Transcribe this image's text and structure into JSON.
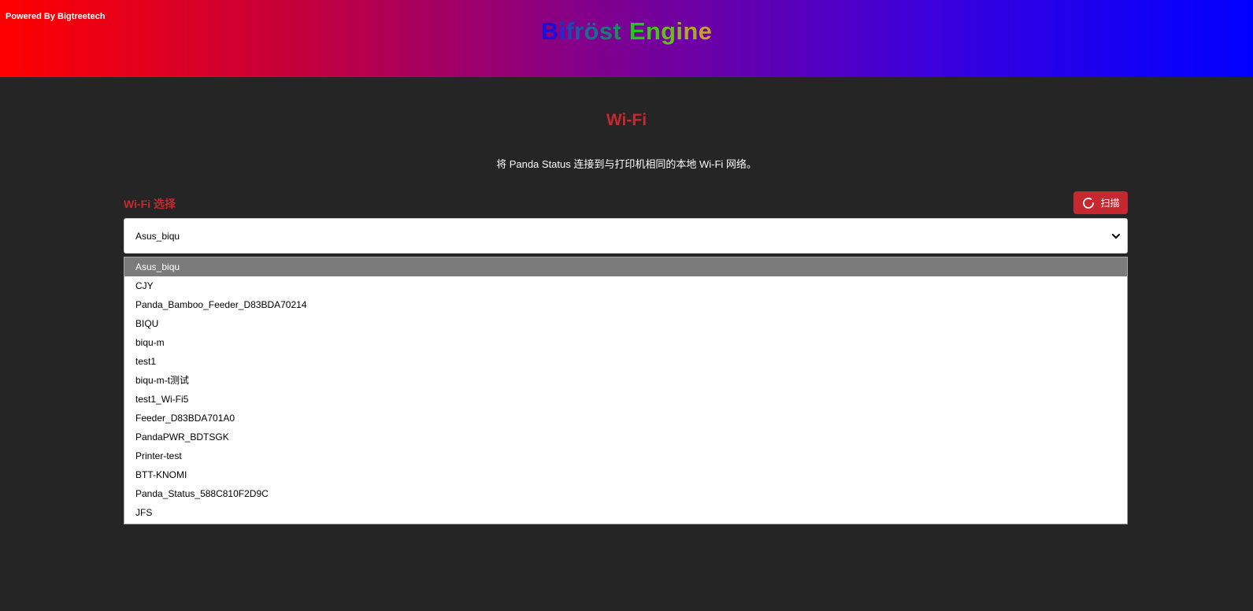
{
  "header": {
    "powered_by": "Powered By Bigtreetech",
    "brand_word1": [
      {
        "ch": "B",
        "color": "#1a10d8"
      },
      {
        "ch": "i",
        "color": "#1b2fd0"
      },
      {
        "ch": "f",
        "color": "#1a48b8"
      },
      {
        "ch": "r",
        "color": "#1a5aa8"
      },
      {
        "ch": "ö",
        "color": "#1b6a90"
      },
      {
        "ch": "s",
        "color": "#1a7a78"
      },
      {
        "ch": "t",
        "color": "#1a8c5c"
      }
    ],
    "brand_word2": [
      {
        "ch": "E",
        "color": "#22c81a"
      },
      {
        "ch": "n",
        "color": "#44c11e"
      },
      {
        "ch": "g",
        "color": "#6aba22"
      },
      {
        "ch": "i",
        "color": "#8cb326"
      },
      {
        "ch": "n",
        "color": "#aaa92a"
      },
      {
        "ch": "e",
        "color": "#c8a02e"
      }
    ]
  },
  "main": {
    "title": "Wi-Fi",
    "description": "将 Panda Status 连接到与打印机相同的本地 Wi-Fi 网络。",
    "wifi_label": "Wi-Fi 选择",
    "scan_label": "扫描",
    "selected_network": "Asus_biqu"
  },
  "networks": [
    "Asus_biqu",
    "CJY",
    "Panda_Bamboo_Feeder_D83BDA70214",
    "BIQU",
    "biqu-m",
    "test1",
    "biqu-m-t测试",
    "test1_Wi-Fi5",
    "Feeder_D83BDA701A0",
    "PandaPWR_BDTSGK",
    "Printer-test",
    "BTT-KNOMI",
    "Panda_Status_588C810F2D9C",
    "JFS"
  ],
  "icons": {
    "scan": "refresh-icon",
    "select": "chevron-down-icon"
  },
  "colors": {
    "accent": "#c5282f",
    "background": "#262526"
  }
}
